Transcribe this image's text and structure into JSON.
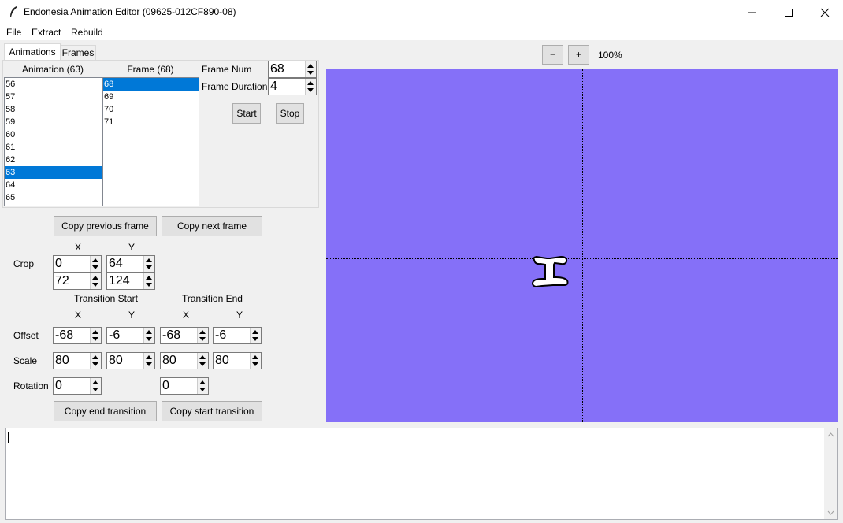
{
  "window": {
    "title": "Endonesia Animation Editor (09625-012CF890-08)"
  },
  "menu": {
    "file": "File",
    "extract": "Extract",
    "rebuild": "Rebuild"
  },
  "tabs": {
    "animations": "Animations",
    "frames": "Frames"
  },
  "animation_list": {
    "header": "Animation (63)",
    "items": [
      "56",
      "57",
      "58",
      "59",
      "60",
      "61",
      "62",
      "63",
      "64",
      "65"
    ],
    "selected": "63"
  },
  "frame_list": {
    "header": "Frame (68)",
    "items": [
      "68",
      "69",
      "70",
      "71"
    ],
    "selected": "68"
  },
  "frame_controls": {
    "frame_num_label": "Frame Num",
    "frame_num": "68",
    "frame_duration_label": "Frame Duration",
    "frame_duration": "4",
    "start": "Start",
    "stop": "Stop"
  },
  "copy": {
    "previous": "Copy previous frame",
    "next": "Copy next frame",
    "end_transition": "Copy end transition",
    "start_transition": "Copy start transition"
  },
  "labels": {
    "x": "X",
    "y": "Y",
    "crop": "Crop",
    "transition_start": "Transition Start",
    "transition_end": "Transition End",
    "offset": "Offset",
    "scale": "Scale",
    "rotation": "Rotation"
  },
  "crop": {
    "x1": "0",
    "y1": "64",
    "x2": "72",
    "y2": "124"
  },
  "offset": {
    "start_x": "-68",
    "start_y": "-6",
    "end_x": "-68",
    "end_y": "-6"
  },
  "scale": {
    "start_x": "80",
    "start_y": "80",
    "end_x": "80",
    "end_y": "80"
  },
  "rotation": {
    "start": "0",
    "end": "0"
  },
  "zoom": {
    "minus": "−",
    "plus": "+",
    "level": "100%"
  },
  "canvas": {
    "background": "#8570f8"
  }
}
